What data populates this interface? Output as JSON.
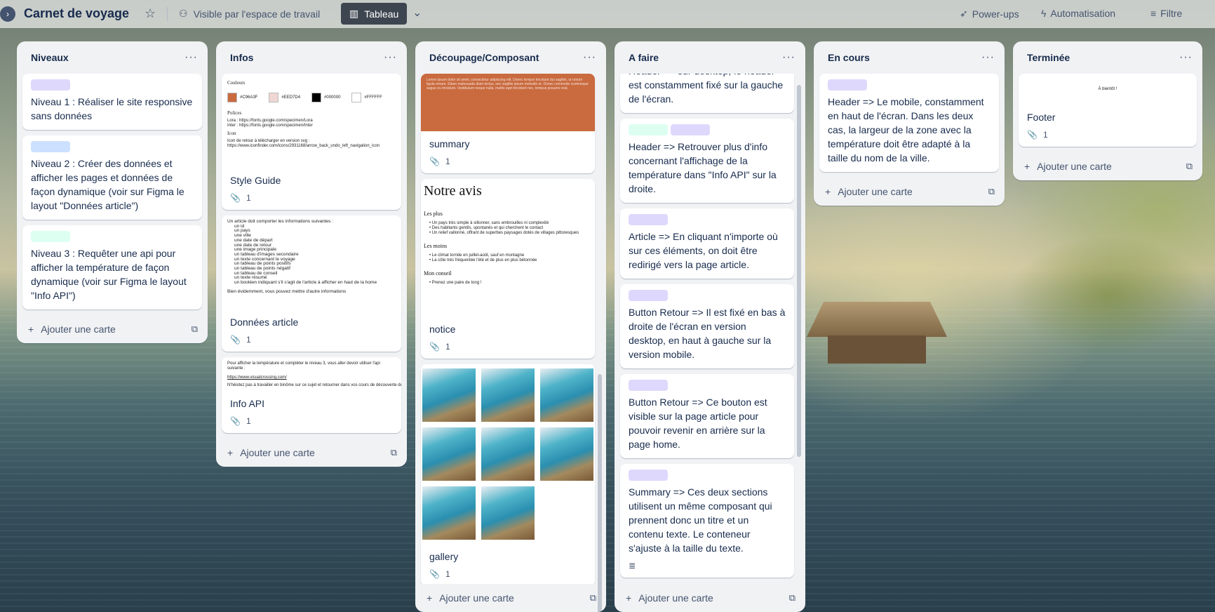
{
  "board": {
    "title": "Carnet de voyage",
    "visibility": "Visible par l'espace de travail",
    "view": "Tableau",
    "powerups": "Power-ups",
    "automation": "Automatisation",
    "filter": "Filtre"
  },
  "add_card_label": "Ajouter une carte",
  "label_colors": {
    "purple": "#dfd8fd",
    "blue": "#cce0ff",
    "green": "#dcfff1"
  },
  "lists": {
    "niveaux": {
      "title": "Niveaux",
      "cards": [
        {
          "label_color": "purple",
          "text": "Niveau 1 : Réaliser le site responsive sans données"
        },
        {
          "label_color": "blue",
          "text": "Niveau 2 : Créer des données et afficher les pages et données de façon dynamique (voir sur Figma le layout \"Données article\")"
        },
        {
          "label_color": "green",
          "text": "Niveau 3 : Requêter une api pour afficher la température de façon dynamique (voir sur Figma le layout \"Info API\")"
        }
      ]
    },
    "infos": {
      "title": "Infos",
      "cards": [
        {
          "title": "Style Guide",
          "attachments": "1",
          "preview": {
            "heading_colors": "Couleurs",
            "swatches": [
              {
                "hex": "#C96A3F",
                "code": "#C96A3F"
              },
              {
                "hex": "#EED7D4",
                "code": "#EED7D4"
              },
              {
                "hex": "#000000",
                "code": "#000000"
              },
              {
                "hex": "#FFFFFF",
                "code": "#FFFFFF"
              }
            ],
            "heading_fonts": "Polices",
            "font_lora": "Lora : https://fonts.google.com/specimen/Lora",
            "font_inter": "Inter : https://fonts.google.com/specimen/Inter",
            "heading_icons": "Icon",
            "icon_text": "Icon de retour à télécharger en version svg :",
            "icon_link": "https://www.iconfinder.com/icons/2931168/arrow_back_undo_left_navigation_icon"
          }
        },
        {
          "title": "Données article",
          "attachments": "1",
          "preview": {
            "intro": "Un article doit comporter les informations suivantes :",
            "items": [
              "un id",
              "un pays",
              "une ville",
              "une date de départ",
              "une date de retour",
              "une image principale",
              "un tableau d'images secondaire",
              "un texte concernant le voyage",
              "un tableau de points positifs",
              "un tableau de points négatif",
              "un tableau de conseil",
              "un texte résumé",
              "un booléen indiquant s'il s'agit de l'article à afficher en haut de la home"
            ],
            "outro": "Bien évidemment, vous pouvez mettre d'autre informations"
          }
        },
        {
          "title": "Info API",
          "attachments": "1",
          "preview": {
            "line1": "Pour afficher la température et compléter le niveau 3, vous aller devoir utiliser l'api suivante :",
            "link": "https://www.visualcrossing.com/",
            "line2": "N'hésitez pas à travailler en binôme sur ce sujet et retourner dans vos cours de découverte des API."
          }
        }
      ]
    },
    "decoupage": {
      "title": "Découpage/Composant",
      "cards": [
        {
          "title": "summary",
          "attachments": "1",
          "cover_color": "#c96a3f",
          "cover_text": "Lorem ipsum dolor sit amet, consectetur adipiscing elit. Donec tempor tincidunt dui sagittis, ut rutrum ligula ornare. Etiam malesuada diam lectus, nec sagittis ipsum molestie et. Donec commodo scelerisque augue eu tincidunt. Vestibulum neque nulla, mattis eget tincidunt nec, tempus posuere erat."
        },
        {
          "title": "notice",
          "attachments": "1",
          "preview": {
            "heading": "Notre avis",
            "plus_title": "Les plus",
            "plus": [
              "Un pays très simple à sillonner, sans embrouilles ni complexité",
              "Des habitants gentils, spontanés et qui cherchent le contact",
              "Un relief vallonné, offrant de superbes paysages dotés de villages pittoresques"
            ],
            "moins_title": "Les moins",
            "moins": [
              "Le climat torride en juillet-août, sauf en montagne",
              "La côte très fréquentée l'été et de plus en plus bétonnée"
            ],
            "conseil_title": "Mon conseil",
            "conseil": [
              "Prenez une paire de tong !"
            ]
          }
        },
        {
          "title": "gallery",
          "attachments": "1",
          "image_count": 8
        }
      ]
    },
    "afaire": {
      "title": "A faire",
      "cards": [
        {
          "labels": [],
          "text": "Header => sur desktop, le header est constamment fixé sur la gauche de l'écran."
        },
        {
          "labels": [
            "green",
            "purple"
          ],
          "text": "Header => Retrouver plus d'info concernant l'affichage de la température dans \"Info API\" sur la droite."
        },
        {
          "labels": [
            "purple"
          ],
          "text": "Article => En cliquant n'importe où sur ces éléments, on doit être redirigé vers la page article."
        },
        {
          "labels": [
            "purple"
          ],
          "text": "Button Retour => Il est fixé en bas à droite de l'écran en version desktop, en haut à gauche sur la version mobile."
        },
        {
          "labels": [
            "purple"
          ],
          "text": "Button Retour => Ce bouton est visible sur la page article pour pouvoir revenir en arrière sur la page home."
        },
        {
          "labels": [
            "purple"
          ],
          "text": "Summary => Ces deux sections utilisent un même composant qui prennent donc un titre et un contenu texte. Le conteneur s'ajuste à la taille du texte."
        }
      ]
    },
    "encours": {
      "title": "En cours",
      "cards": [
        {
          "label_color": "purple",
          "text": "Header => Le mobile, constamment en haut de l'écran. Dans les deux cas, la largeur de la zone avec la température doit être adapté à la taille du nom de la ville."
        }
      ]
    },
    "terminee": {
      "title": "Terminée",
      "cards": [
        {
          "title": "Footer",
          "attachments": "1",
          "preview_text": "À bientôt !"
        }
      ]
    }
  }
}
